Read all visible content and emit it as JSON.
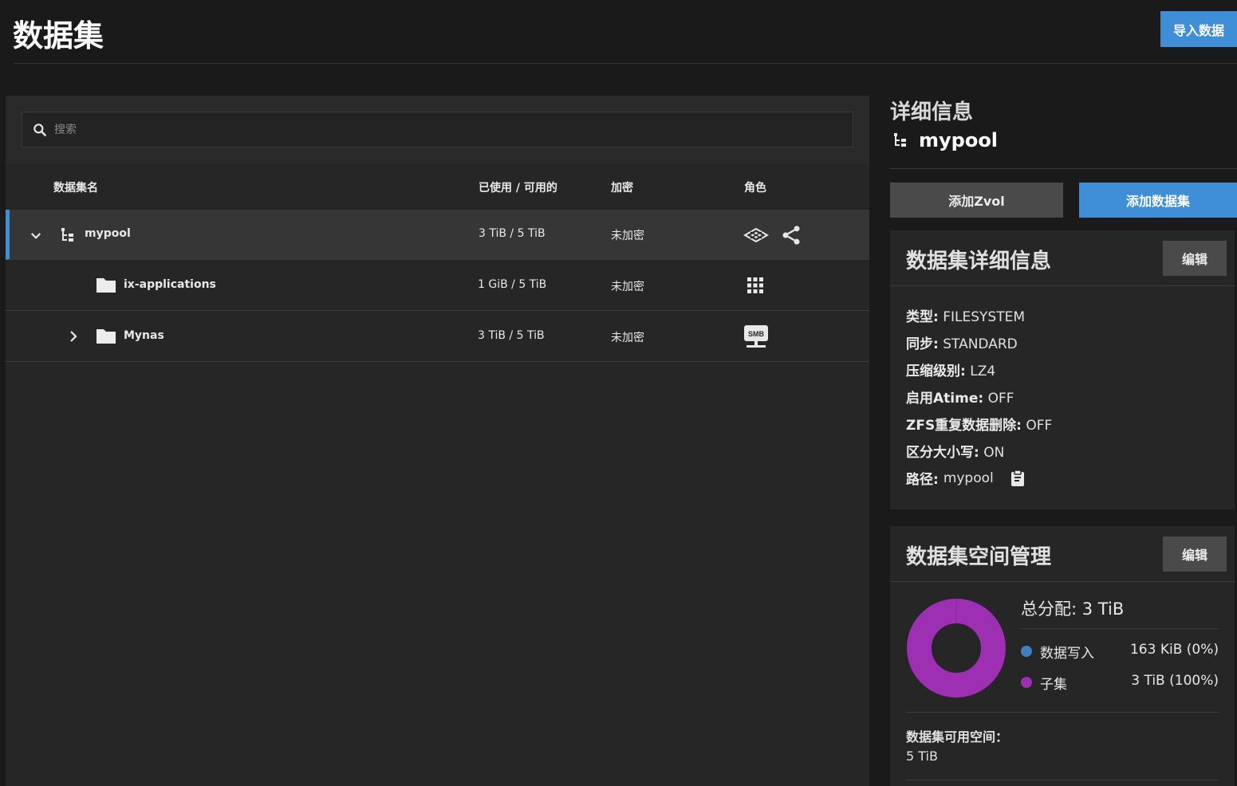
{
  "header": {
    "title": "数据集",
    "import_label": "导入数据"
  },
  "search": {
    "placeholder": "搜索"
  },
  "table": {
    "columns": [
      "数据集名",
      "已使用 / 可用的",
      "加密",
      "角色"
    ],
    "rows": [
      {
        "name": "mypool",
        "usage": "3 TiB / 5 TiB",
        "encryption": "未加密",
        "expanded": true
      },
      {
        "name": "ix-applications",
        "usage": "1 GiB / 5 TiB",
        "encryption": "未加密"
      },
      {
        "name": "Mynas",
        "usage": "3 TiB / 5 TiB",
        "encryption": "未加密",
        "expanded": false,
        "role_badge": "SMB"
      }
    ]
  },
  "details": {
    "title": "详细信息",
    "pool_name": "mypool",
    "add_zvol_label": "添加Zvol",
    "add_dataset_label": "添加数据集"
  },
  "dataset_card": {
    "title": "数据集详细信息",
    "edit_label": "编辑",
    "items": [
      {
        "key": "类型:",
        "value": "FILESYSTEM"
      },
      {
        "key": "同步:",
        "value": "STANDARD"
      },
      {
        "key": "压缩级别:",
        "value": "LZ4"
      },
      {
        "key": "启用Atime:",
        "value": "OFF"
      },
      {
        "key": "ZFS重复数据删除:",
        "value": "OFF"
      },
      {
        "key": "区分大小写:",
        "value": "ON"
      },
      {
        "key": "路径:",
        "value": "mypool"
      }
    ]
  },
  "space_card": {
    "title": "数据集空间管理",
    "edit_label": "编辑",
    "total_label": "总分配:",
    "total_value": "3 TiB",
    "legend": [
      {
        "label": "数据写入",
        "value": "163 KiB (0%)",
        "color": "#3f7fc4"
      },
      {
        "label": "子集",
        "value": "3 TiB (100%)",
        "color": "#9c2fb2"
      }
    ],
    "available_label": "数据集可用空间：",
    "available_value": "5 TiB"
  },
  "colors": {
    "accent": "#3f8fd8",
    "chart_child": "#9c2fb2",
    "chart_data": "#3f7fc4"
  },
  "chart_data": {
    "type": "pie",
    "categories": [
      "数据写入",
      "子集"
    ],
    "values": [
      0,
      100
    ]
  }
}
